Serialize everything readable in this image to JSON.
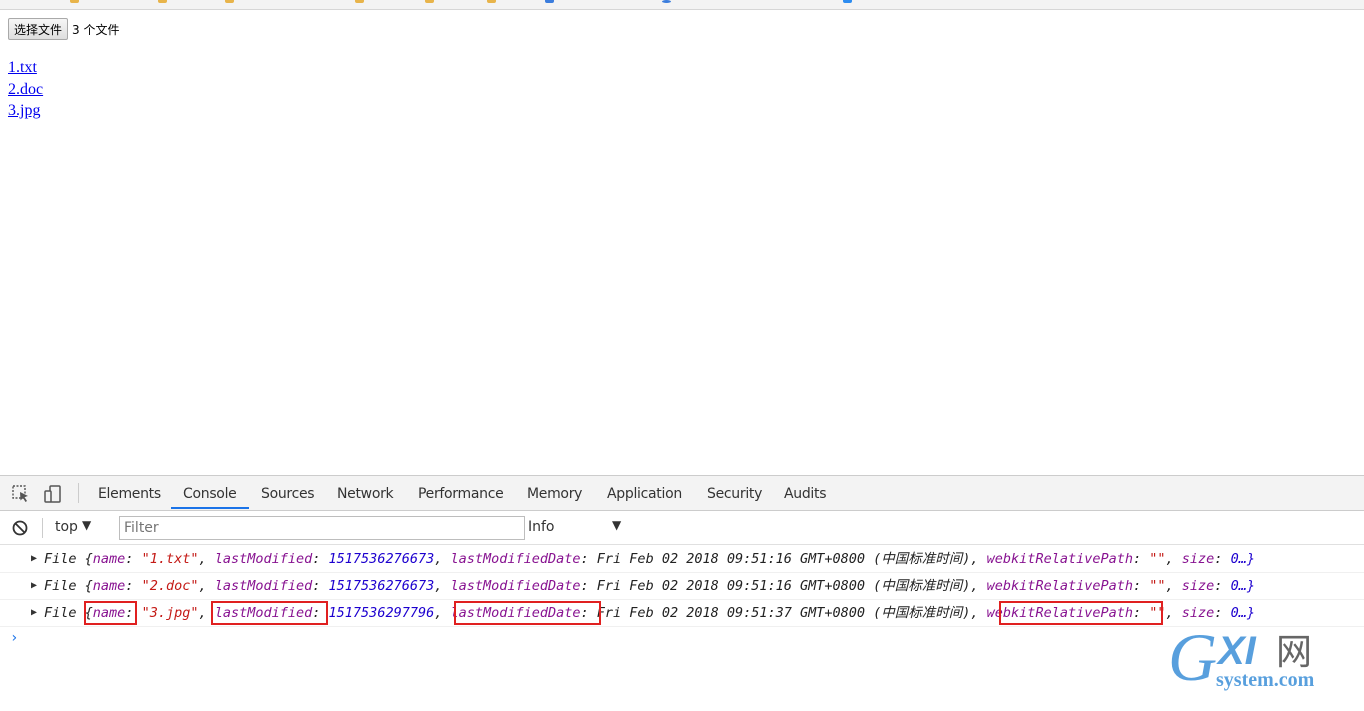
{
  "page": {
    "choose_button": "选择文件",
    "file_count": "3 个文件",
    "files": [
      "1.txt",
      "2.doc",
      "3.jpg"
    ]
  },
  "devtools": {
    "tabs": [
      "Elements",
      "Console",
      "Sources",
      "Network",
      "Performance",
      "Memory",
      "Application",
      "Security",
      "Audits"
    ],
    "active_tab": "Console",
    "context": "top",
    "filter_placeholder": "Filter",
    "level": "Info",
    "logs": [
      {
        "prefix": "File {",
        "name_key": "name",
        "name_val": "\"1.txt\"",
        "lm_key": "lastModified",
        "lm_val": "1517536276673",
        "lmd_key": "lastModifiedDate",
        "lmd_val": "Fri Feb 02 2018 09:51:16 GMT+0800 (中国标准时间)",
        "wrp_key": "webkitRelativePath",
        "wrp_val": "\"\"",
        "size_key": "size",
        "size_val": "0…}"
      },
      {
        "prefix": "File {",
        "name_key": "name",
        "name_val": "\"2.doc\"",
        "lm_key": "lastModified",
        "lm_val": "1517536276673",
        "lmd_key": "lastModifiedDate",
        "lmd_val": "Fri Feb 02 2018 09:51:16 GMT+0800 (中国标准时间)",
        "wrp_key": "webkitRelativePath",
        "wrp_val": "\"\"",
        "size_key": "size",
        "size_val": "0…}"
      },
      {
        "prefix": "File {",
        "name_key": "name",
        "name_val": "\"3.jpg\"",
        "lm_key": "lastModified",
        "lm_val": "1517536297796",
        "lmd_key": "lastModifiedDate",
        "lmd_val": "Fri Feb 02 2018 09:51:37 GMT+0800 (中国标准时间)",
        "wrp_key": "webkitRelativePath",
        "wrp_val": "\"\"",
        "size_key": "size",
        "size_val": "0…}"
      }
    ],
    "prompt": "›"
  },
  "watermark": {
    "text": "GXI网",
    "sub": "system.com"
  },
  "colors": {
    "link": "#0000ee",
    "key": "#881391",
    "string": "#c41a16",
    "number": "#1c00cf",
    "highlight": "#e02020",
    "accent": "#1a73e8"
  }
}
